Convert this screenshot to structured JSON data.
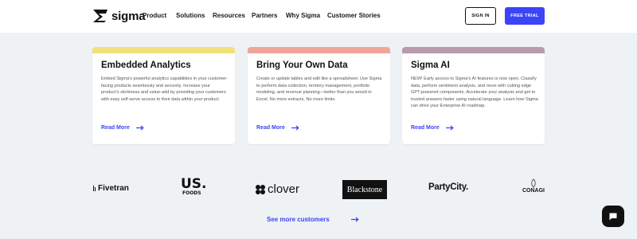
{
  "header": {
    "logo_text": "sigma",
    "nav": [
      "Product",
      "Solutions",
      "Resources",
      "Partners",
      "Why Sigma",
      "Customer Stories"
    ],
    "sign_in_label": "SIGN IN",
    "free_trial_label": "FREE TRIAL",
    "accent_color": "#3b44f6"
  },
  "cards": [
    {
      "title": "Embedded Analytics",
      "bar_color": "#f2e07a",
      "body": "Embed Sigma's powerful analytics capabilities in your customer-facing products seamlessly and securely. Increase your product's stickiness and value-add by providing your customers with easy self-serve access to their data within your product.",
      "link": "Read More"
    },
    {
      "title": "Bring Your Own Data",
      "bar_color": "#f0a59a",
      "body": "Create or update tables and edit like a spreadsheet. Use Sigma to perform data collection, territory management, portfolio modeling, and revenue planning—better than you would in Excel. No more extracts. No more limits.",
      "link": "Read More"
    },
    {
      "title": "Sigma AI",
      "bar_color": "#b89aae",
      "body": "NEW! Early access to Sigma's AI features is now open. Classify data, perform sentiment analysis, and more with cutting edge GPT-powered components. Accelerate your analysis and get to trusted answers faster using natural language.  Learn how Sigma can drive your Enterprise AI roadmap.",
      "link": "Read More"
    }
  ],
  "customers": {
    "fivetran": "Fivetran",
    "usfoods_main": "US.",
    "usfoods_sub": "FOODS",
    "clover": "clover",
    "blackstone": "Blackstone",
    "partycity": "PartyCity.",
    "conagra": "CONAGI"
  },
  "see_more": "See more customers"
}
